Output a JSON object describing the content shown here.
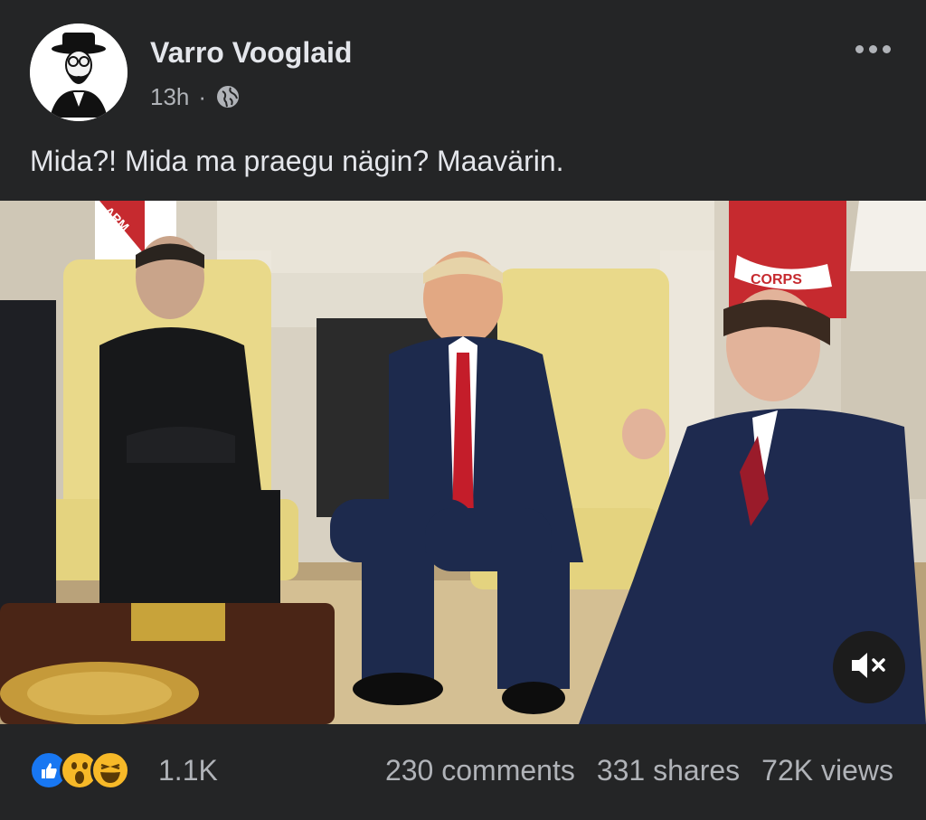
{
  "post": {
    "author": "Varro Vooglaid",
    "time": "13h",
    "separator": "·",
    "privacy_icon": "globe-icon",
    "text": "Mida?! Mida ma praegu nägin? Maavärin."
  },
  "video": {
    "flag_left_text": "ARM",
    "flag_right_text": "CORPS",
    "mute_icon": "speaker-muted-icon"
  },
  "footer": {
    "reactions": [
      "like-icon",
      "wow-icon",
      "haha-icon"
    ],
    "reaction_count": "1.1K",
    "comments": "230 comments",
    "shares": "331 shares",
    "views": "72K views"
  },
  "colors": {
    "background": "#242526",
    "text_primary": "#e4e6eb",
    "text_secondary": "#b0b3b8",
    "like_blue": "#1877f2",
    "reaction_yellow": "#f7b928"
  }
}
